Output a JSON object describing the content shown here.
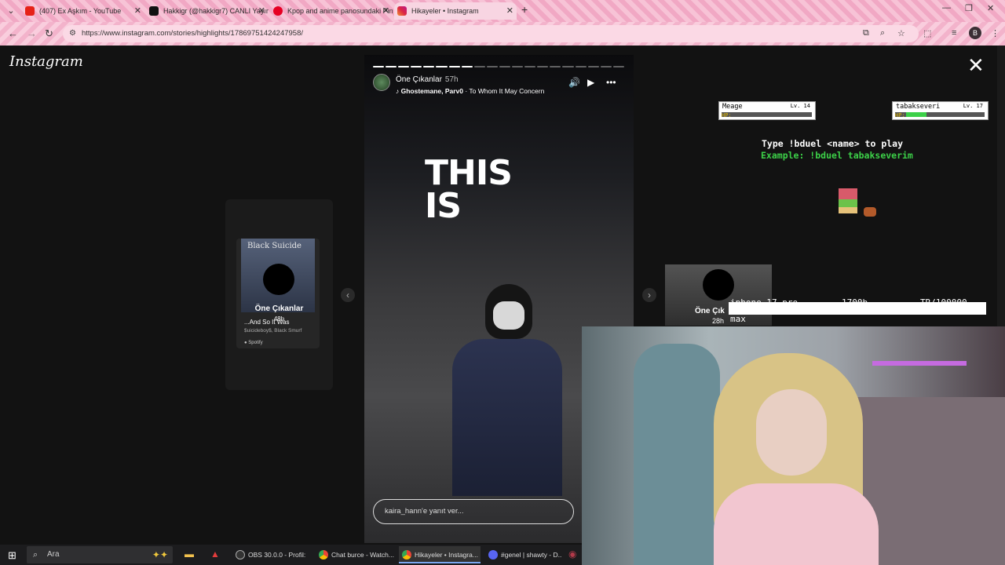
{
  "browser": {
    "tabs": [
      {
        "label": "(407) Ex Aşkım - YouTube",
        "icon": "youtube-icon",
        "color": "#e62117"
      },
      {
        "label": "Hakkigr (@hakkigr7) CANLI Yayın",
        "icon": "tiktok-icon",
        "color": "#111111"
      },
      {
        "label": "Kpop and anime panosundaki Pin",
        "icon": "pinterest-icon",
        "color": "#e60023"
      },
      {
        "label": "Hikayeler • Instagram",
        "icon": "instagram-icon",
        "color": "#d6249f"
      }
    ],
    "url": "https://www.instagram.com/stories/highlights/17869751424247958/",
    "profile_initial": "B"
  },
  "instagram": {
    "logo": "Instagram",
    "prev_story": {
      "album_title": "Black Suicide",
      "name": "Öne Çıkanlar",
      "time": "48h",
      "song": "...And So It Was",
      "artists": "$uicideboy$, Black Smurf",
      "source": "Spotify"
    },
    "story": {
      "user": "Öne Çıkanlar",
      "age": "57h",
      "music_artist": "Ghostemane, Parv0",
      "music_title": "To Whom It May Concern",
      "overlay_text": [
        "THIS",
        "IS"
      ],
      "reply_placeholder": "kaira_hann'e yanıt ver...",
      "segments_total": 20,
      "segments_done": 8
    },
    "next_story": {
      "name": "Öne Çık",
      "time": "28h"
    }
  },
  "stream_overlay": {
    "player1": {
      "name": "Meage",
      "level": "Lv. 14",
      "hp_label": "HP:"
    },
    "player2": {
      "name": "tabakseveri",
      "level": "Lv. 17",
      "hp_label": "HP:"
    },
    "instruction": "Type !bduel <name> to play",
    "example": "Example: !bduel tabakseverim",
    "product": "iphone 17 pro",
    "product_price": "1700b",
    "product_currency": "TR/100000",
    "product_sub": "max"
  },
  "taskbar": {
    "search_placeholder": "Ara",
    "apps": [
      {
        "label": "OBS 30.0.0 - Profil: ...",
        "icon": "obs-icon",
        "color": "#333333"
      },
      {
        "label": "Chat burce - Watch...",
        "icon": "chrome-icon",
        "color": "#34a853"
      },
      {
        "label": "Hikayeler • Instagra...",
        "icon": "chrome-icon",
        "color": "#34a853"
      },
      {
        "label": "#genel | shawty - D...",
        "icon": "discord-icon",
        "color": "#5865f2"
      }
    ]
  }
}
